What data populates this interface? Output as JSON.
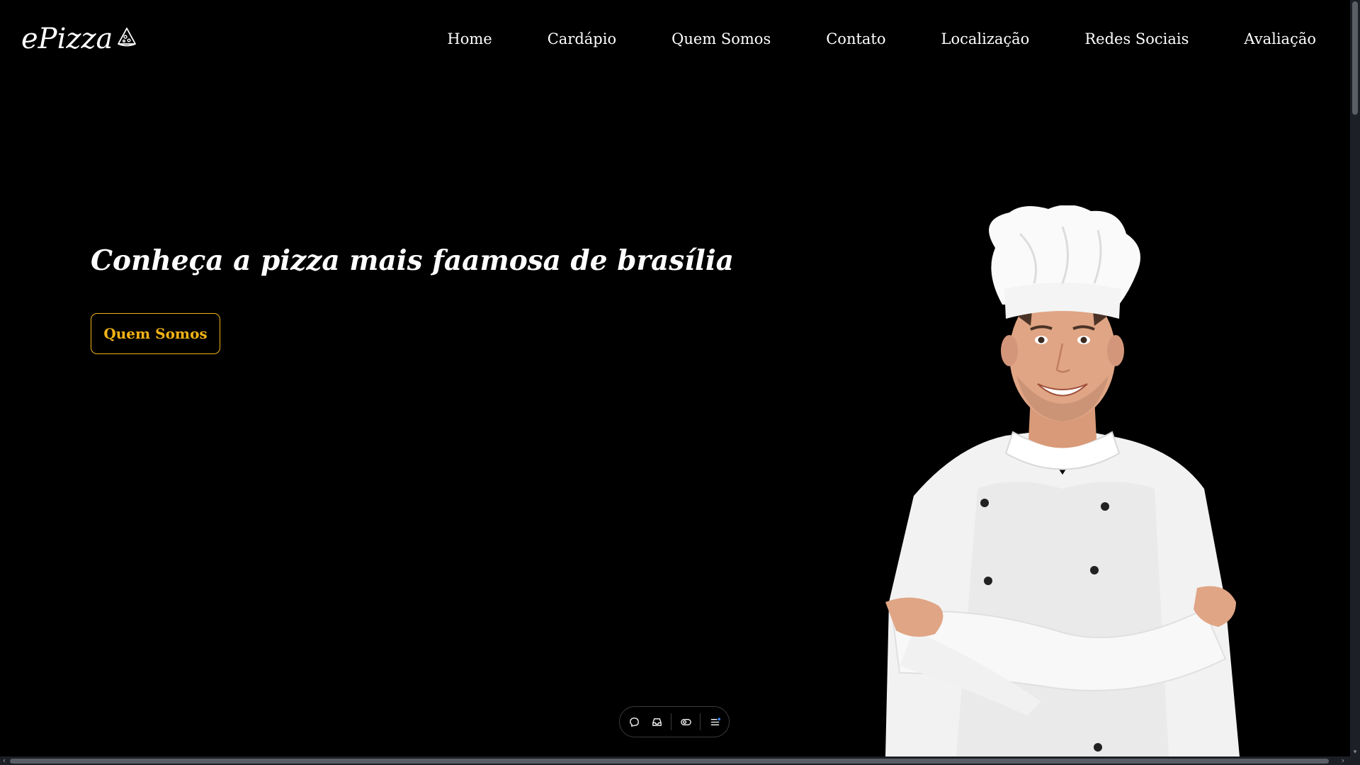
{
  "header": {
    "logo_text": "ePizza",
    "logo_icon": "pizza-slice-icon",
    "nav": [
      {
        "label": "Home"
      },
      {
        "label": "Cardápio"
      },
      {
        "label": "Quem Somos"
      },
      {
        "label": "Contato"
      },
      {
        "label": "Localização"
      },
      {
        "label": "Redes Sociais"
      },
      {
        "label": "Avaliação"
      }
    ]
  },
  "hero": {
    "headline": "Conheça a pizza mais faamosa de brasília",
    "cta_label": "Quem Somos",
    "image": "chef-arms-crossed-photo"
  },
  "toolbar": {
    "icons": [
      "chat-bubble-icon",
      "inbox-icon",
      "toggle-icon",
      "menu-list-icon"
    ]
  },
  "colors": {
    "background": "#000000",
    "text": "#ffffff",
    "accent": "#f2b316"
  }
}
